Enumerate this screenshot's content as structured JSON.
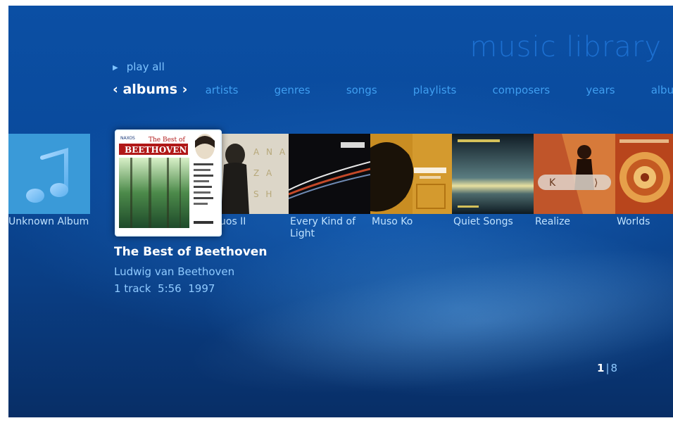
{
  "header": {
    "title": "music library",
    "play_all": "play all",
    "current_view": "‹ albums ›",
    "tabs": [
      "artists",
      "genres",
      "songs",
      "playlists",
      "composers",
      "years",
      "albu"
    ]
  },
  "albums": [
    {
      "caption": "Unknown Album",
      "icon": "music-note-icon"
    },
    {
      "caption": "Luciana Souza - Duos II",
      "visible_caption": "uos II"
    },
    {
      "caption": "Every Kind of Light"
    },
    {
      "caption": "Muso Ko"
    },
    {
      "caption": "Quiet Songs"
    },
    {
      "caption": "Realize"
    },
    {
      "caption": "Worlds"
    }
  ],
  "selected": {
    "cover_header": "The Best of",
    "cover_title": "BEETHOVEN",
    "label": "NAXOS",
    "title": "The Best of Beethoven",
    "artist": "Ludwig van Beethoven",
    "details": "1 track  5:56  1997"
  },
  "pager": {
    "current": "1",
    "total": "8"
  },
  "colors": {
    "accent": "#3f9ef0",
    "background": "#0a4a9c",
    "selected_text": "#ffffff"
  }
}
